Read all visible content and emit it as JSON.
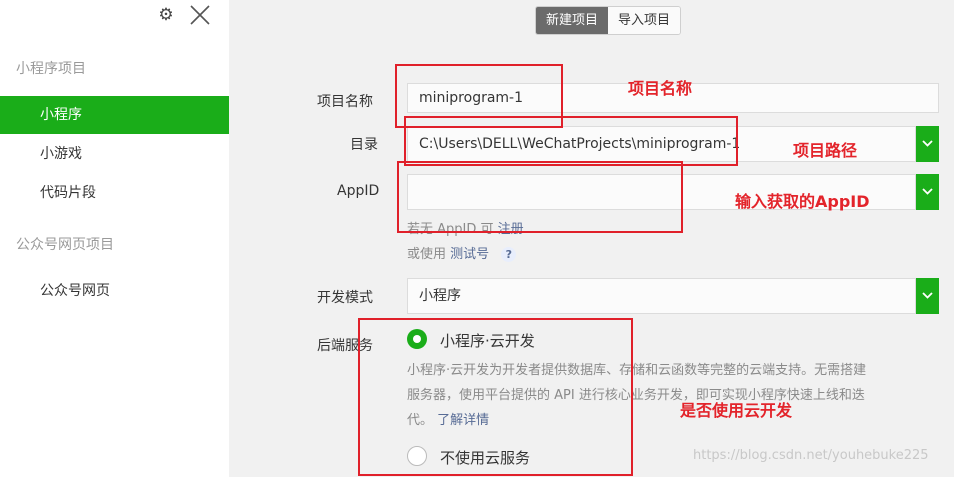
{
  "sidebar": {
    "section_miniprogram": "小程序项目",
    "items_mp": [
      {
        "label": "小程序",
        "active": true
      },
      {
        "label": "小游戏",
        "active": false
      },
      {
        "label": "代码片段",
        "active": false
      }
    ],
    "section_official": "公众号网页项目",
    "items_official": [
      {
        "label": "公众号网页",
        "active": false
      }
    ]
  },
  "tabs": {
    "new_project": "新建项目",
    "import_project": "导入项目"
  },
  "form": {
    "project_name_label": "项目名称",
    "project_name_value": "miniprogram-1",
    "directory_label": "目录",
    "directory_value": "C:\\Users\\DELL\\WeChatProjects\\miniprogram-1",
    "appid_label": "AppID",
    "appid_value": "",
    "appid_hint_prefix": "若无 AppID 可",
    "appid_hint_link": "注册",
    "test_prefix": "或使用",
    "test_link": "测试号",
    "test_help": "?",
    "dev_mode_label": "开发模式",
    "dev_mode_value": "小程序",
    "backend_label": "后端服务",
    "backend_option_cloud": "小程序·云开发",
    "backend_desc_line1": "小程序·云开发为开发者提供数据库、存储和云函数等完整的云端支持。无需搭建",
    "backend_desc_line2": "服务器，使用平台提供的 API 进行核心业务开发，即可实现小程序快速上线和迭",
    "backend_desc_line3": "代。",
    "backend_desc_link": "了解详情",
    "backend_option_none": "不使用云服务"
  },
  "annotations": {
    "name": "项目名称",
    "path": "项目路径",
    "appid": "输入获取的AppID",
    "cloud": "是否使用云开发"
  },
  "watermark": "https://blog.csdn.net/youhebuke225",
  "colors": {
    "accent": "#1aad19",
    "annotation": "#e3242b",
    "link": "#576b95"
  }
}
